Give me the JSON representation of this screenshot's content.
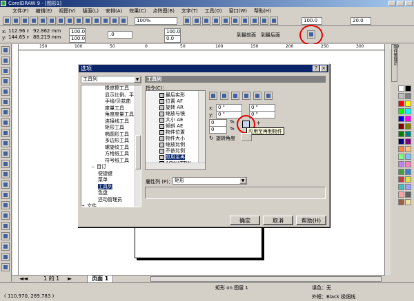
{
  "window": {
    "title": "CorelDRAW 9 - [图形1]"
  },
  "menu": [
    "文件(F)",
    "编辑(E)",
    "视图(V)",
    "版面(L)",
    "安排(A)",
    "效果(C)",
    "点阵图(B)",
    "文字(T)",
    "工具(O)",
    "窗口(W)",
    "帮助(H)"
  ],
  "toolbar": {
    "zoom": "100%"
  },
  "propbar": {
    "x": "112.96 mm",
    "y": "144.65 mm",
    "w": "92.862 mm",
    "h": "88.219 mm",
    "sx": "100.0",
    "sy": "100.0",
    "angle": ".0",
    "pos1": "100.0",
    "pos2": "20.0",
    "pos3": "100.0",
    "pos4": "0.0",
    "front_label": "到最前面",
    "back_label": "到最后面"
  },
  "ruler": {
    "ticks": [
      "150",
      "100",
      "50",
      "0",
      "50",
      "100",
      "150",
      "200",
      "250",
      "300",
      "350"
    ]
  },
  "dialog": {
    "title": "选项",
    "help_mark": "?",
    "close_mark": "×",
    "category_dropdown": "工具列",
    "tree_items": [
      "橡皮擦工具",
      "显示比例、平",
      "手绘/贝兹曲",
      "度量工具",
      "角度度量工具",
      "连接线工具",
      "矩形工具",
      "椭圆形工具",
      "多边形工具",
      "螺旋纹工具",
      "方格纸工具",
      "符号纸工具",
      "目订",
      "便捷键",
      "菜单",
      "工具列",
      "色盘",
      "还动管理员",
      "文件",
      "广域"
    ],
    "tree_selected": "工具列",
    "tree_toggle_open": "−",
    "tree_toggle_closed": "+",
    "panel_title": "工具列",
    "commands_label": "指令(C)：",
    "command_items": [
      "最后实形",
      "位置 AF",
      "旋转 AR",
      "缩放与镜",
      "大小 AE",
      "倾斜 AE",
      "物件位置",
      "物件大小",
      "缩放比例",
      "不依比例",
      "应用至再",
      "AQWATTW"
    ],
    "command_selected": "应用至再",
    "grid_labels": {
      "x": "x:",
      "y": "y:"
    },
    "grid_values": {
      "x1": "0 \"",
      "x2": "0 \"",
      "y1": "0 \"",
      "y2": "0 \""
    },
    "pct_values": {
      "p1": "0",
      "p2": "0"
    },
    "pct_unit": "%",
    "rotate_label": "旋转角度",
    "tooltip": "应用至再制物件",
    "plus_glyph": "+",
    "attr_label": "屬性列 (P)：",
    "attr_value": "矩形",
    "buttons": {
      "ok": "确定",
      "cancel": "取消",
      "help": "帮助(H)"
    }
  },
  "page_tabs": {
    "counter": "1 的 1",
    "page": "页面 1"
  },
  "status": {
    "coords": "( 110.970, 289.783 )",
    "object": "矩形 on 图层 1",
    "fill_label": "填色：无",
    "outline_label": "外框：Black 极细线"
  },
  "docker": {
    "label": "物件管理员"
  },
  "palette": [
    "#ffffff",
    "#000000",
    "#c0c0c0",
    "#808080",
    "#ff0000",
    "#ffff00",
    "#00ff00",
    "#00ffff",
    "#0000ff",
    "#ff00ff",
    "#800000",
    "#808000",
    "#008000",
    "#008080",
    "#000080",
    "#800080",
    "#ff8040",
    "#ffc080",
    "#80ff80",
    "#80c0ff",
    "#c080ff",
    "#ff80c0",
    "#40a040",
    "#4080c0",
    "#c04040",
    "#e0e040",
    "#40c0c0",
    "#a0a0ff",
    "#ffa0a0",
    "#606060",
    "#a06040",
    "#f0e0a0"
  ],
  "colors": {
    "accent_circle": "#e00000",
    "title_blue": "#0a246a",
    "select_blue": "#0a246a"
  }
}
